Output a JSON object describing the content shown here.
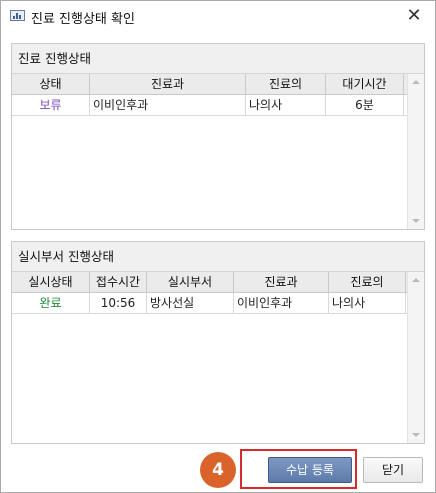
{
  "window": {
    "title": "진료 진행상태 확인",
    "close_glyph": "✕"
  },
  "colors": {
    "status_hold": "#7c4bb2",
    "status_done": "#1f8a3a",
    "primary_button": "#6b86b5",
    "highlight": "#d72a2a",
    "step_badge": "#d9632a"
  },
  "clinic_panel": {
    "title": "진료 진행상태",
    "columns": [
      "상태",
      "진료과",
      "진료의",
      "대기시간"
    ],
    "rows": [
      {
        "status": "보류",
        "department": "이비인후과",
        "doctor": "나의사",
        "wait_time": "6분"
      }
    ]
  },
  "exam_panel": {
    "title": "실시부서 진행상태",
    "columns": [
      "실시상태",
      "접수시간",
      "실시부서",
      "진료과",
      "진료의"
    ],
    "rows": [
      {
        "status": "완료",
        "reception_time": "10:56",
        "exam_dept": "방사선실",
        "department": "이비인후과",
        "doctor": "나의사"
      }
    ]
  },
  "footer": {
    "step_number": "4",
    "register_label": "수납 등록",
    "close_label": "닫기"
  }
}
